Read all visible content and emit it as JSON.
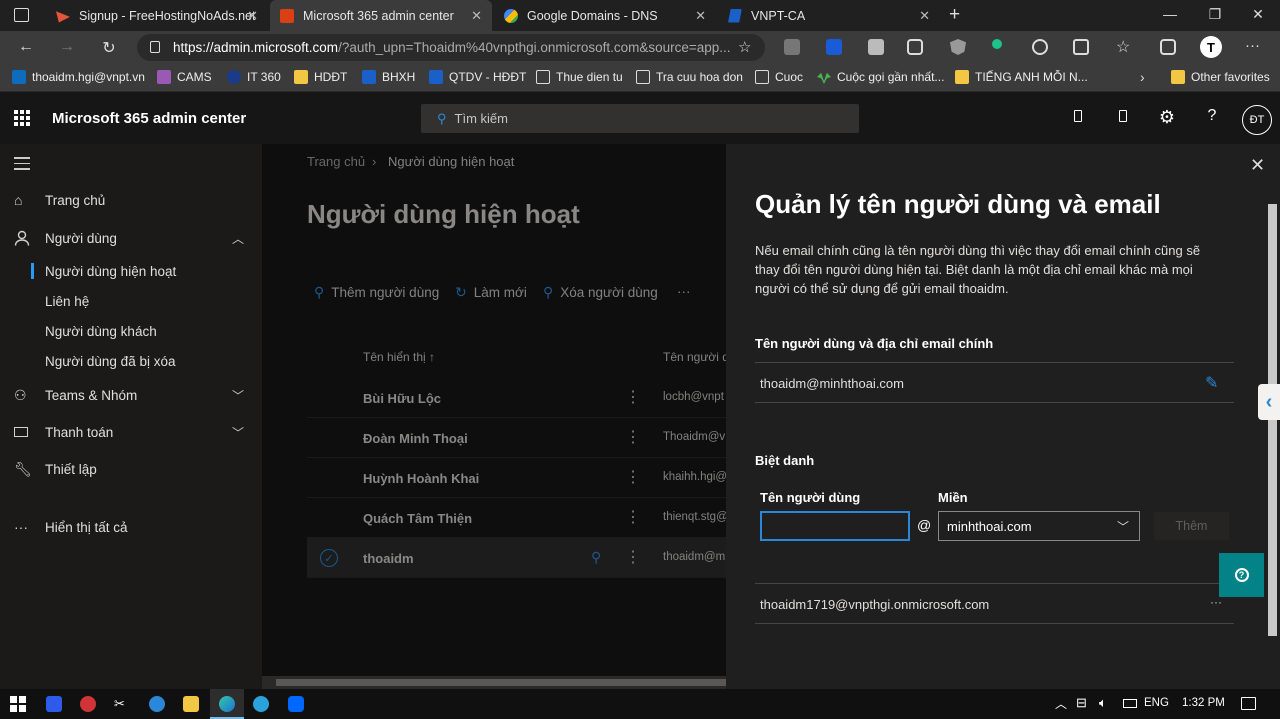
{
  "browser": {
    "tabs": [
      {
        "title": "Signup - FreeHostingNoAds.net",
        "favicon": "freehosting-icon",
        "active": false
      },
      {
        "title": "Microsoft 365 admin center",
        "favicon": "office-icon",
        "active": true
      },
      {
        "title": "Google Domains - DNS",
        "favicon": "google-domains-icon",
        "active": false
      },
      {
        "title": "VNPT-CA",
        "favicon": "vnpt-ca-icon",
        "active": false
      }
    ],
    "url_host": "https://admin.microsoft.com",
    "url_rest": "/?auth_upn=Thoaidm%40vnpthgi.onmicrosoft.com&source=app...",
    "favorites": [
      "thoaidm.hgi@vnpt.vn",
      "CAMS",
      "IT 360",
      "HDĐT",
      "BHXH",
      "QTDV - HĐĐT",
      "Thue dien tu",
      "Tra cuu hoa don",
      "Cuoc",
      "Cuộc gọi gần nhất...",
      "TIẾNG ANH MỖI N..."
    ],
    "other_favorites": "Other favorites"
  },
  "header": {
    "app_title": "Microsoft 365 admin center",
    "search_placeholder": "Tìm kiếm",
    "avatar_initials": "ĐT"
  },
  "nav": {
    "home": "Trang chủ",
    "users": "Người dùng",
    "users_sub": [
      "Người dùng hiện hoạt",
      "Liên hệ",
      "Người dùng khách",
      "Người dùng đã bị xóa"
    ],
    "teams": "Teams & Nhóm",
    "billing": "Thanh toán",
    "setup": "Thiết lập",
    "show_all": "Hiển thị tất cả"
  },
  "main": {
    "breadcrumb_home": "Trang chủ",
    "breadcrumb_current": "Người dùng hiện hoạt",
    "page_title": "Người dùng hiện hoạt",
    "commands": {
      "add_user": "Thêm người dùng",
      "refresh": "Làm mới",
      "delete_user": "Xóa người dùng",
      "more": "···"
    },
    "columns": {
      "display_name": "Tên hiển thị ↑",
      "username": "Tên người dù"
    },
    "rows": [
      {
        "name": "Bùi Hữu Lộc",
        "email": "locbh@vnpt"
      },
      {
        "name": "Đoàn Minh Thoại",
        "email": "Thoaidm@v"
      },
      {
        "name": "Huỳnh Hoành Khai",
        "email": "khaihh.hgi@"
      },
      {
        "name": "Quách Tâm Thiện",
        "email": "thienqt.stg@"
      },
      {
        "name": "thoaidm",
        "email": "thoaidm@m",
        "selected": true
      }
    ]
  },
  "panel": {
    "title": "Quản lý tên người dùng và email",
    "description": "Nếu email chính cũng là tên người dùng thì việc thay đổi email chính cũng sẽ thay đổi tên người dùng hiện tại. Biệt danh là một địa chỉ email khác mà mọi người có thể sử dụng để gửi email thoaidm.",
    "primary_label": "Tên người dùng và địa chỉ email chính",
    "primary_value": "thoaidm@minhthoai.com",
    "alias_label": "Biệt danh",
    "username_label": "Tên người dùng",
    "domain_label": "Miền",
    "at_sign": "@",
    "domain_value": "minhthoai.com",
    "add_button": "Thêm",
    "alias_value": "thoaidm1719@vnpthgi.onmicrosoft.com",
    "alias_more": "···"
  },
  "taskbar": {
    "lang": "ENG",
    "time": "1:32 PM"
  },
  "colors": {
    "accent": "#2b88d8",
    "panel_bg": "#1f1f1f",
    "page_bg": "#161616"
  }
}
